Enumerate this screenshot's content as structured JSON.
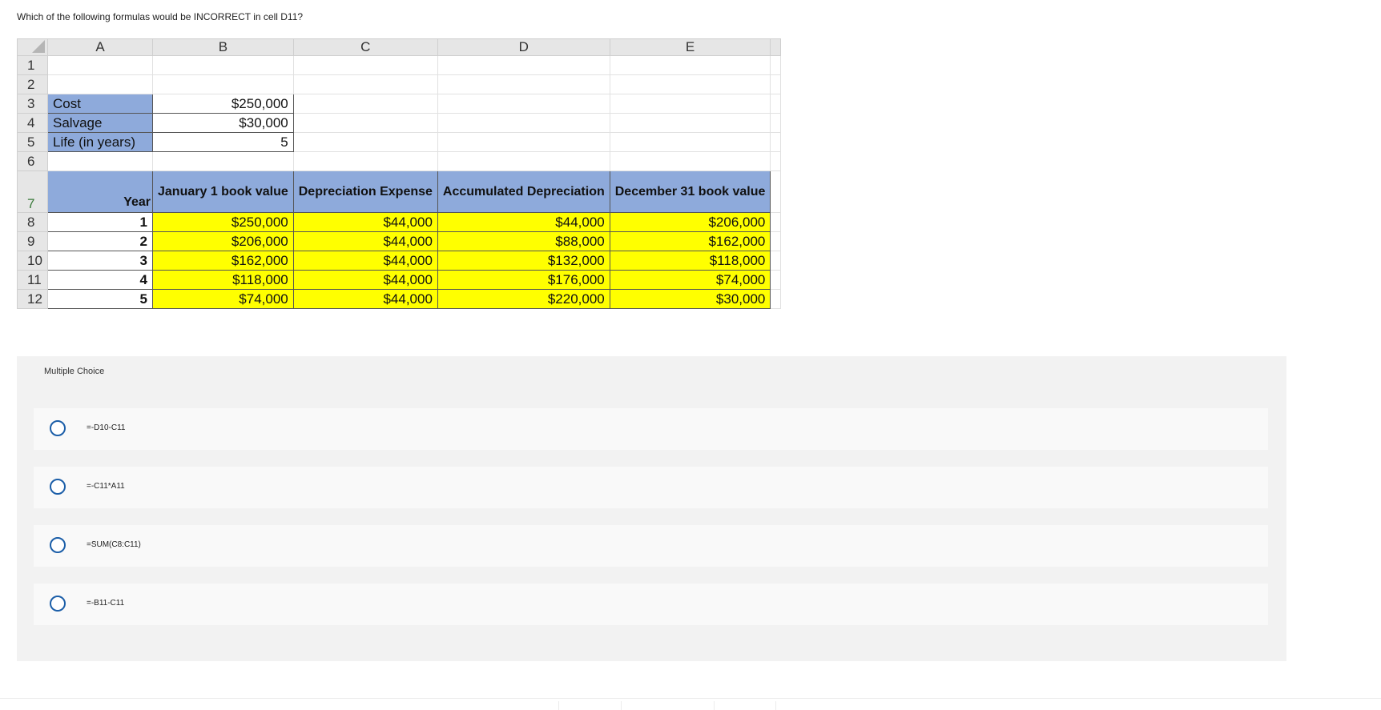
{
  "question": "Which of the following formulas would be INCORRECT in cell D11?",
  "sheet": {
    "columns": [
      "A",
      "B",
      "C",
      "D",
      "E"
    ],
    "row_numbers": [
      "1",
      "2",
      "3",
      "4",
      "5",
      "6",
      "7",
      "8",
      "9",
      "10",
      "11",
      "12"
    ],
    "inputs": [
      {
        "label": "Cost",
        "value": "$250,000"
      },
      {
        "label": "Salvage",
        "value": "$30,000"
      },
      {
        "label": "Life (in years)",
        "value": "5"
      }
    ],
    "headers": [
      "Year",
      "January 1 book value",
      "Depreciation Expense",
      "Accumulated Depreciation",
      "December 31 book value"
    ],
    "rows": [
      [
        "1",
        "$250,000",
        "$44,000",
        "$44,000",
        "$206,000"
      ],
      [
        "2",
        "$206,000",
        "$44,000",
        "$88,000",
        "$162,000"
      ],
      [
        "3",
        "$162,000",
        "$44,000",
        "$132,000",
        "$118,000"
      ],
      [
        "4",
        "$118,000",
        "$44,000",
        "$176,000",
        "$74,000"
      ],
      [
        "5",
        "$74,000",
        "$44,000",
        "$220,000",
        "$30,000"
      ]
    ]
  },
  "multiple_choice": {
    "title": "Multiple Choice",
    "options": [
      "=-D10-C11",
      "=-C11*A11",
      "=SUM(C8:C11)",
      "=-B11-C11"
    ]
  }
}
